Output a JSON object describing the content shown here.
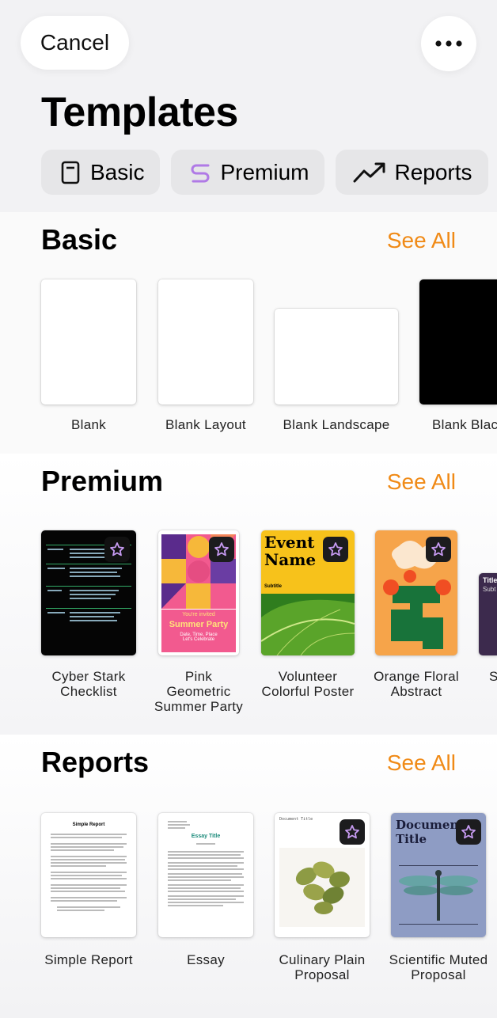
{
  "header": {
    "cancel_label": "Cancel",
    "more_icon": "ellipsis-icon",
    "title": "Templates"
  },
  "chips": [
    {
      "label": "Basic",
      "icon": "document-icon"
    },
    {
      "label": "Premium",
      "icon": "premium-swirl-icon"
    },
    {
      "label": "Reports",
      "icon": "trend-up-icon"
    }
  ],
  "sections": {
    "basic": {
      "title": "Basic",
      "see_all": "See All",
      "items": [
        {
          "label": "Blank"
        },
        {
          "label": "Blank Layout"
        },
        {
          "label": "Blank Landscape"
        },
        {
          "label": "Blank Blac"
        }
      ]
    },
    "premium": {
      "title": "Premium",
      "see_all": "See All",
      "items": [
        {
          "label": "Cyber Stark\nChecklist"
        },
        {
          "label": "Pink\nGeometric\nSummer Party",
          "thumb_text": {
            "headline": "Summer Party",
            "invite": "You're invited",
            "details": "Date, Time, Place\nLet's Celebrate"
          }
        },
        {
          "label": "Volunteer\nColorful Poster",
          "thumb_text": {
            "headline": "Event\nName",
            "subtitle": "Subtitle"
          }
        },
        {
          "label": "Orange Floral\nAbstract"
        },
        {
          "label": "S",
          "thumb_text": {
            "title": "Title",
            "sub": "Subt"
          }
        }
      ]
    },
    "reports": {
      "title": "Reports",
      "see_all": "See All",
      "items": [
        {
          "label": "Simple Report",
          "thumb_text": {
            "title": "Simple Report"
          }
        },
        {
          "label": "Essay",
          "thumb_text": {
            "title": "Essay Title"
          }
        },
        {
          "label": "Culinary Plain\nProposal",
          "thumb_text": {
            "title": "Document Title"
          }
        },
        {
          "label": "Scientific Muted\nProposal",
          "thumb_text": {
            "title": "Document\nTitle"
          }
        }
      ]
    }
  },
  "colors": {
    "accent": "#f08a16",
    "premium_badge": "#1c1c1e",
    "premium_icon": "#b07ae6"
  }
}
